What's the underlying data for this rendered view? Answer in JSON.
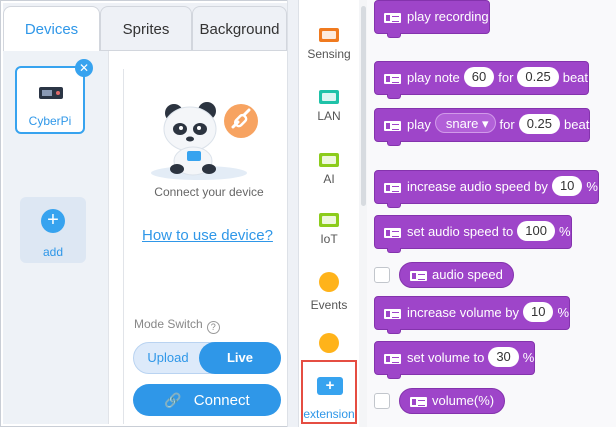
{
  "tabs": [
    "Devices",
    "Sprites",
    "Background"
  ],
  "device": {
    "name": "CyberPi",
    "remove_glyph": "✕",
    "add_glyph": "+",
    "add_label": "add"
  },
  "panel": {
    "connect_msg": "Connect your device",
    "howto_link": "How to use device?",
    "mode_switch_label": "Mode Switch",
    "help_glyph": "?",
    "mode_upload": "Upload",
    "mode_live": "Live",
    "connect_glyph": "🔗",
    "connect_label": "Connect"
  },
  "categories": [
    {
      "label": "Sensing",
      "icon": "sensing-icon",
      "color": "#f07a1f"
    },
    {
      "label": "LAN",
      "icon": "lan-icon",
      "color": "#1fc2a8"
    },
    {
      "label": "AI",
      "icon": "ai-icon",
      "color": "#8ccc1c"
    },
    {
      "label": "IoT",
      "icon": "iot-icon",
      "color": "#8ccc1c"
    },
    {
      "label": "Events",
      "icon": "events-icon",
      "color": "#ffb31a"
    },
    {
      "label": "",
      "icon": "control-icon",
      "color": "#ffb31a"
    }
  ],
  "extension": {
    "label": "extension",
    "glyph": "+",
    "highlight": "#e54d42"
  },
  "blocks": {
    "play_recording": "play recording",
    "play_note": {
      "prefix": "play note",
      "note": "60",
      "for_text": "for",
      "beats": "0.25",
      "suffix": "beat"
    },
    "play_sound": {
      "prefix": "play",
      "sound": "snare",
      "arrow": "▾",
      "for_text": "for",
      "beats": "0.25",
      "suffix": "beat"
    },
    "increase_speed": {
      "prefix": "increase audio speed by",
      "value": "10",
      "suffix": "%"
    },
    "set_speed": {
      "prefix": "set audio speed to",
      "value": "100",
      "suffix": "%"
    },
    "audio_speed": "audio speed",
    "increase_volume": {
      "prefix": "increase volume by",
      "value": "10",
      "suffix": "%"
    },
    "set_volume": {
      "prefix": "set volume to",
      "value": "30",
      "suffix": "%"
    },
    "volume": "volume(%)"
  },
  "colors": {
    "accent": "#2f97e8",
    "audio_block": "#9e45c9"
  }
}
